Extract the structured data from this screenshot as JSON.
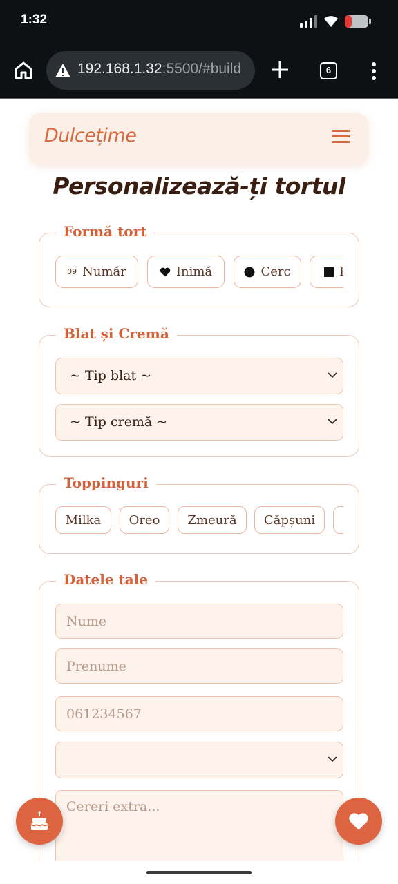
{
  "status_bar": {
    "time": "1:32",
    "icons": [
      "signal-icon",
      "wifi-icon",
      "battery-icon"
    ],
    "battery_color": "#e53935"
  },
  "browser": {
    "url_host": "192.168.1.32",
    "url_rest": ":5500/#build",
    "tab_count": "6",
    "icons": [
      "home-icon",
      "warning-icon",
      "plus-icon",
      "tabs-icon",
      "more-vertical-icon"
    ]
  },
  "header": {
    "brand": "Dulcețime",
    "menu_icon": "hamburger-menu-icon"
  },
  "page_title": "Personalizează-ți tortul",
  "shape_section": {
    "legend": "Formă tort",
    "options": [
      {
        "label": "Număr",
        "icon": "number-icon",
        "icon_text": "09"
      },
      {
        "label": "Inimă",
        "icon": "heart-icon"
      },
      {
        "label": "Cerc",
        "icon": "circle-icon"
      },
      {
        "label": "P",
        "icon": "square-icon"
      }
    ]
  },
  "cake_section": {
    "legend": "Blat și Cremă",
    "sponge_select": "~ Tip blat ~",
    "cream_select": "~ Tip cremă ~"
  },
  "toppings_section": {
    "legend": "Toppinguri",
    "items": [
      "Milka",
      "Oreo",
      "Zmeură",
      "Căpșuni"
    ]
  },
  "details_section": {
    "legend": "Datele tale",
    "name_placeholder": "Nume",
    "surname_placeholder": "Prenume",
    "phone_placeholder": "061234567",
    "extra_select": "",
    "requests_placeholder": "Cereri extra..."
  },
  "fabs": {
    "left_icon": "cake-icon",
    "right_icon": "heart-icon"
  },
  "colors": {
    "accent": "#d66a3f",
    "fab": "#dc6440",
    "field_bg": "#fdf3ec",
    "border": "#efb49d",
    "header_bg": "#fcefe7"
  }
}
